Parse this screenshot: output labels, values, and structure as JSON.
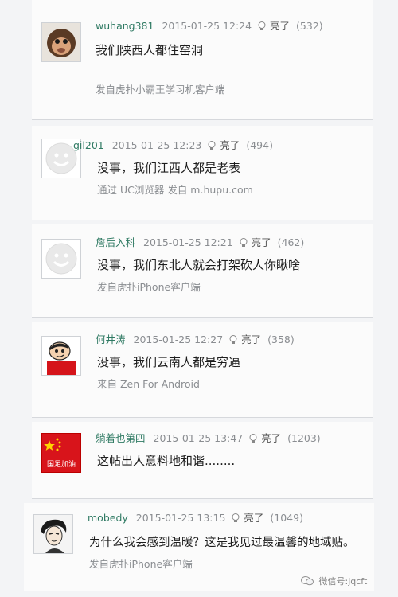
{
  "comments": [
    {
      "user": "wuhang381",
      "time": "2015-01-25 12:24",
      "like": "亮了",
      "count": "(532)",
      "text": "我们陕西人都住窑洞",
      "source": "发自虎扑小霸王学习机客户端",
      "avatar": "monkey-avatar-icon"
    },
    {
      "user": "gil201",
      "time": "2015-01-25 12:23",
      "like": "亮了",
      "count": "(494)",
      "text": "没事，我们江西人都是老表",
      "source": "通过 UC浏览器 发自 m.hupu.com",
      "avatar": "default-smiley-avatar-icon"
    },
    {
      "user": "詹后入科",
      "time": "2015-01-25 12:21",
      "like": "亮了",
      "count": "(462)",
      "text": "没事，我们东北人就会打架砍人你瞅啥",
      "source": "发自虎扑iPhone客户端",
      "avatar": "default-smiley-avatar-icon"
    },
    {
      "user": "何井涛",
      "time": "2015-01-25 12:27",
      "like": "亮了",
      "count": "(358)",
      "text": "没事，我们云南人都是穷逼",
      "source": "来自 Zen For Android",
      "avatar": "cartoon-boy-avatar-icon"
    },
    {
      "user": "躺着也第四",
      "time": "2015-01-25 13:47",
      "like": "亮了",
      "count": "(1203)",
      "text": "这帖出人意料地和谐........",
      "source": "",
      "avatar": "flag-avatar-icon",
      "avatar_text": "国足加油"
    },
    {
      "user": "mobedy",
      "time": "2015-01-25 13:15",
      "like": "亮了",
      "count": "(1049)",
      "text": "为什么我会感到温暖？这是我见过最温馨的地域贴。",
      "source": "发自虎扑iPhone客户端",
      "avatar": "manga-portrait-avatar-icon"
    }
  ],
  "watermark": "微信号:jqcft",
  "colors": {
    "username": "#2f7a63",
    "meta": "#8a8d91",
    "flag_red": "#d8141b",
    "flag_star": "#ffd400"
  }
}
